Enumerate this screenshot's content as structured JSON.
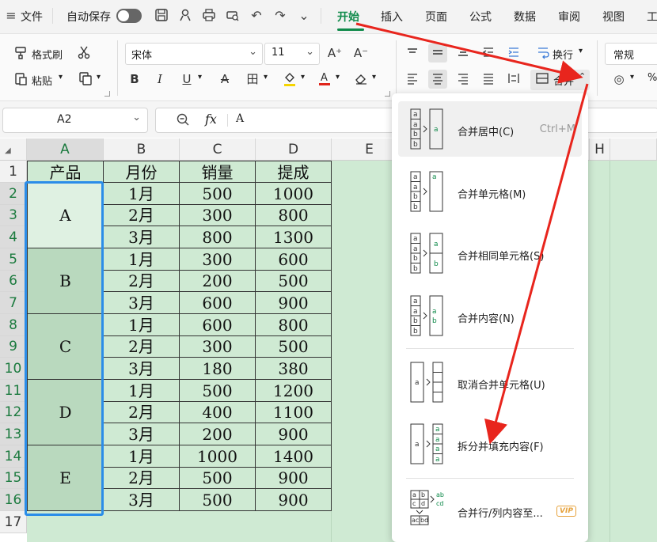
{
  "menubar": {
    "hamburger": "≡",
    "file": "文件",
    "autosave": "自动保存",
    "undo_icon": "↶",
    "redo_icon": "↷",
    "more_icon": "⌄",
    "tabs": [
      "开始",
      "插入",
      "页面",
      "公式",
      "数据",
      "审阅",
      "视图",
      "工"
    ]
  },
  "ribbon": {
    "format_painter": "格式刷",
    "paste": "粘贴",
    "paste_arrow": "▾",
    "copy_arrow": "▾",
    "font_name": "宋体",
    "font_size": "11",
    "grow_font": "A⁺",
    "shrink_font": "A⁻",
    "bold": "B",
    "italic": "I",
    "underline": "U",
    "strike": "A",
    "border_icon": "田",
    "fill_icon": "◈",
    "font_color_icon": "A",
    "clear_icon": "◇",
    "wrap_text": "换行",
    "merge": "合并",
    "number_format": "常规",
    "percent": "%",
    "coin_icon": "◎"
  },
  "formula_bar": {
    "cell_ref": "A2",
    "fx": "fx",
    "value": "A"
  },
  "sheet": {
    "columns": [
      "A",
      "B",
      "C",
      "D",
      "E",
      "H"
    ],
    "rows": [
      "1",
      "2",
      "3",
      "4",
      "5",
      "6",
      "7",
      "8",
      "9",
      "10",
      "11",
      "12",
      "13",
      "14",
      "15",
      "16",
      "17"
    ],
    "headers": [
      "产品",
      "月份",
      "销量",
      "提成"
    ],
    "products": [
      "A",
      "B",
      "C",
      "D",
      "E"
    ],
    "data": [
      [
        "1月",
        "500",
        "1000"
      ],
      [
        "2月",
        "300",
        "800"
      ],
      [
        "3月",
        "800",
        "1300"
      ],
      [
        "1月",
        "300",
        "600"
      ],
      [
        "2月",
        "200",
        "500"
      ],
      [
        "3月",
        "600",
        "900"
      ],
      [
        "1月",
        "600",
        "800"
      ],
      [
        "2月",
        "300",
        "500"
      ],
      [
        "3月",
        "180",
        "380"
      ],
      [
        "1月",
        "500",
        "1200"
      ],
      [
        "2月",
        "400",
        "1100"
      ],
      [
        "3月",
        "200",
        "900"
      ],
      [
        "1月",
        "1000",
        "1400"
      ],
      [
        "2月",
        "500",
        "900"
      ],
      [
        "3月",
        "500",
        "900"
      ]
    ]
  },
  "dropdown": {
    "items": [
      {
        "label": "合并居中(C)",
        "shortcut": "Ctrl+M"
      },
      {
        "label": "合并单元格(M)"
      },
      {
        "label": "合并相同单元格(S)"
      },
      {
        "label": "合并内容(N)"
      },
      {
        "label": "取消合并单元格(U)"
      },
      {
        "label": "拆分并填充内容(F)"
      },
      {
        "label": "合并行/列内容至..."
      }
    ],
    "vip_badge": "VIP",
    "icon_letters": {
      "a": "a",
      "b": "b",
      "ab": "ab",
      "c": "c",
      "d": "d",
      "cd": "cd",
      "dc": "dc",
      "db": "db"
    }
  },
  "colors": {
    "accent": "#0f8a4a",
    "sheet_green": "#cfead3",
    "selection_blue": "#2b8de8",
    "arrow_red": "#e8251d"
  }
}
